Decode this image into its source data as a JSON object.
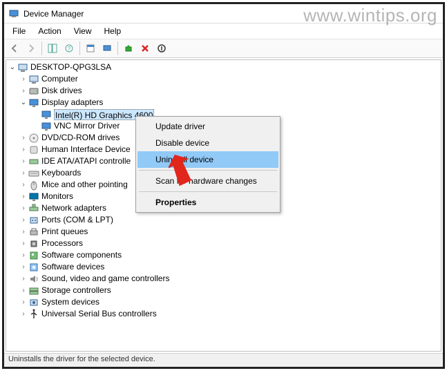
{
  "window": {
    "title": "Device Manager"
  },
  "menu": {
    "file": "File",
    "action": "Action",
    "view": "View",
    "help": "Help"
  },
  "root": "DESKTOP-QPG3LSA",
  "tree": [
    {
      "label": "Computer",
      "icon": "computer-icon",
      "expandable": true
    },
    {
      "label": "Disk drives",
      "icon": "disk-icon",
      "expandable": true
    },
    {
      "label": "Display adapters",
      "icon": "display-icon",
      "expandable": true,
      "expanded": true,
      "children": [
        {
          "label": "Intel(R) HD Graphics 4600",
          "icon": "display-icon",
          "selected": true
        },
        {
          "label": "VNC Mirror Driver",
          "icon": "display-icon"
        }
      ]
    },
    {
      "label": "DVD/CD-ROM drives",
      "icon": "optical-icon",
      "expandable": true
    },
    {
      "label": "Human Interface Device",
      "icon": "hid-icon",
      "expandable": true,
      "truncated": true
    },
    {
      "label": "IDE ATA/ATAPI controlle",
      "icon": "ide-icon",
      "expandable": true,
      "truncated": true
    },
    {
      "label": "Keyboards",
      "icon": "keyboard-icon",
      "expandable": true
    },
    {
      "label": "Mice and other pointing",
      "icon": "mouse-icon",
      "expandable": true,
      "truncated": true
    },
    {
      "label": "Monitors",
      "icon": "monitor-icon",
      "expandable": true
    },
    {
      "label": "Network adapters",
      "icon": "network-icon",
      "expandable": true
    },
    {
      "label": "Ports (COM & LPT)",
      "icon": "port-icon",
      "expandable": true
    },
    {
      "label": "Print queues",
      "icon": "printer-icon",
      "expandable": true
    },
    {
      "label": "Processors",
      "icon": "cpu-icon",
      "expandable": true
    },
    {
      "label": "Software components",
      "icon": "swcomp-icon",
      "expandable": true
    },
    {
      "label": "Software devices",
      "icon": "swdev-icon",
      "expandable": true
    },
    {
      "label": "Sound, video and game controllers",
      "icon": "sound-icon",
      "expandable": true
    },
    {
      "label": "Storage controllers",
      "icon": "storage-icon",
      "expandable": true
    },
    {
      "label": "System devices",
      "icon": "system-icon",
      "expandable": true
    },
    {
      "label": "Universal Serial Bus controllers",
      "icon": "usb-icon",
      "expandable": true
    }
  ],
  "context_menu": {
    "items": [
      {
        "label": "Update driver"
      },
      {
        "label": "Disable device"
      },
      {
        "label": "Uninstall device",
        "highlighted": true
      },
      {
        "type": "sep"
      },
      {
        "label": "Scan for hardware changes"
      },
      {
        "type": "sep"
      },
      {
        "label": "Properties",
        "bold": true
      }
    ]
  },
  "statusbar": "Uninstalls the driver for the selected device.",
  "watermark": "www.wintips.org"
}
